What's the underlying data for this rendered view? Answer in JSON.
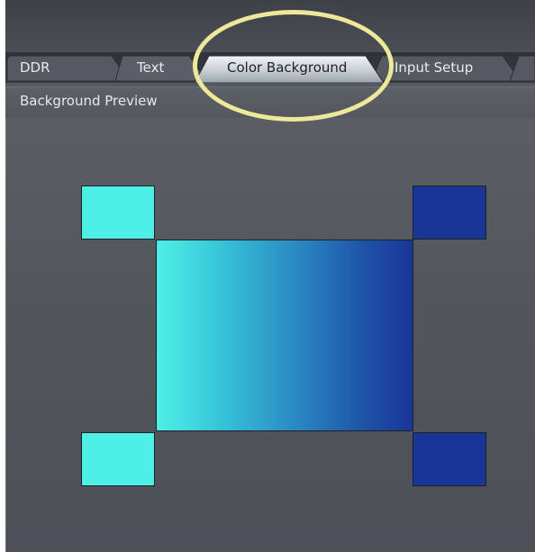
{
  "tabs": [
    {
      "label": "DDR",
      "active": false
    },
    {
      "label": "Text",
      "active": false
    },
    {
      "label": "Color Background",
      "active": true
    },
    {
      "label": "Input Setup",
      "active": false
    }
  ],
  "panel": {
    "title": "Background Preview"
  },
  "colors": {
    "top_left": "#4ef0e6",
    "top_right": "#1a3598",
    "bottom_left": "#4ef0e6",
    "bottom_right": "#1a3598",
    "highlight": "#ede89a"
  }
}
